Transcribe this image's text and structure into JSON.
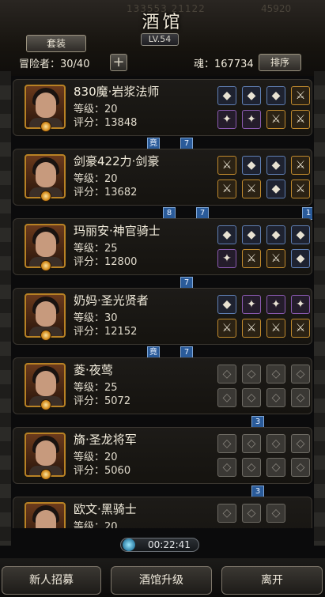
{
  "header": {
    "ghost_left": "133553    21122",
    "ghost_right": "45920",
    "title": "酒馆",
    "level": "LV.54",
    "set_button": "套装",
    "adventurers": "冒险者：30/40",
    "plus": "+",
    "soul": "魂：167734",
    "sort_button": "排序"
  },
  "heroes": [
    {
      "name": "830魔·岩浆法师",
      "level": "等级：20",
      "score": "评分：13848",
      "slots": [
        "blue",
        "blue",
        "blue",
        "orange",
        "purple",
        "purple",
        "orange",
        "orange"
      ],
      "connectors": [
        {
          "label": "竟"
        },
        {
          "label": "7"
        }
      ]
    },
    {
      "name": "剑豪422力·剑豪",
      "level": "等级：20",
      "score": "评分：13682",
      "slots": [
        "orange",
        "blue",
        "blue",
        "orange",
        "orange",
        "orange",
        "blue",
        "orange"
      ],
      "connectors": [
        {
          "label": "8"
        },
        {
          "label": "7"
        },
        {
          "label": "1"
        }
      ]
    },
    {
      "name": "玛丽安·神官骑士",
      "level": "等级：25",
      "score": "评分：12800",
      "slots": [
        "blue",
        "blue",
        "blue",
        "blue",
        "purple",
        "orange",
        "orange",
        "blue"
      ],
      "connectors": [
        {
          "label": "7"
        }
      ]
    },
    {
      "name": "奶妈·圣光贤者",
      "level": "等级：30",
      "score": "评分：12152",
      "slots": [
        "blue",
        "purple",
        "purple",
        "purple",
        "orange",
        "orange",
        "orange",
        "orange"
      ],
      "connectors": [
        {
          "label": "竟"
        },
        {
          "label": "7"
        }
      ]
    },
    {
      "name": "菱·夜莺",
      "level": "等级：25",
      "score": "评分：5072",
      "slots": [
        "empty",
        "empty",
        "empty",
        "empty",
        "empty",
        "empty",
        "empty",
        "empty"
      ],
      "connectors": [
        {
          "label": "3"
        }
      ]
    },
    {
      "name": "旖·圣龙将军",
      "level": "等级：20",
      "score": "评分：5060",
      "slots": [
        "empty",
        "empty",
        "empty",
        "empty",
        "empty",
        "empty",
        "empty",
        "empty"
      ],
      "connectors": [
        {
          "label": "3"
        }
      ]
    },
    {
      "name": "欧文·黑骑士",
      "level": "等级：20",
      "score": "",
      "slots": [
        "empty",
        "empty",
        "empty"
      ],
      "connectors": []
    }
  ],
  "timer": "00:22:41",
  "bottom": {
    "recruit": "新人招募",
    "upgrade": "酒馆升级",
    "leave": "离开"
  }
}
